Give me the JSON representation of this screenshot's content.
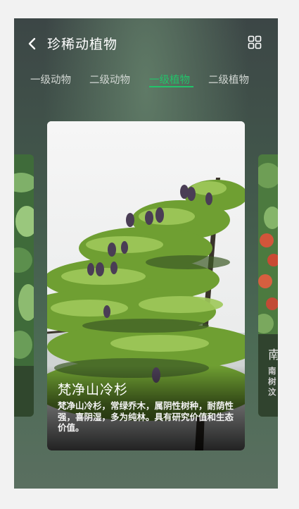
{
  "header": {
    "title": "珍稀动植物"
  },
  "tabs": [
    {
      "label": "一级动物",
      "active": false
    },
    {
      "label": "二级动物",
      "active": false
    },
    {
      "label": "一级植物",
      "active": true
    },
    {
      "label": "二级植物",
      "active": false
    }
  ],
  "accent_color": "#22c46a",
  "main_card": {
    "title": "梵净山冷杉",
    "description": "梵净山冷杉，常绿乔木，属阴性树种，耐荫性强，喜阴湿，多为纯林。具有研究价值和生态价值。"
  },
  "right_card": {
    "title_partial": "南",
    "desc_partial": "南树汶"
  }
}
